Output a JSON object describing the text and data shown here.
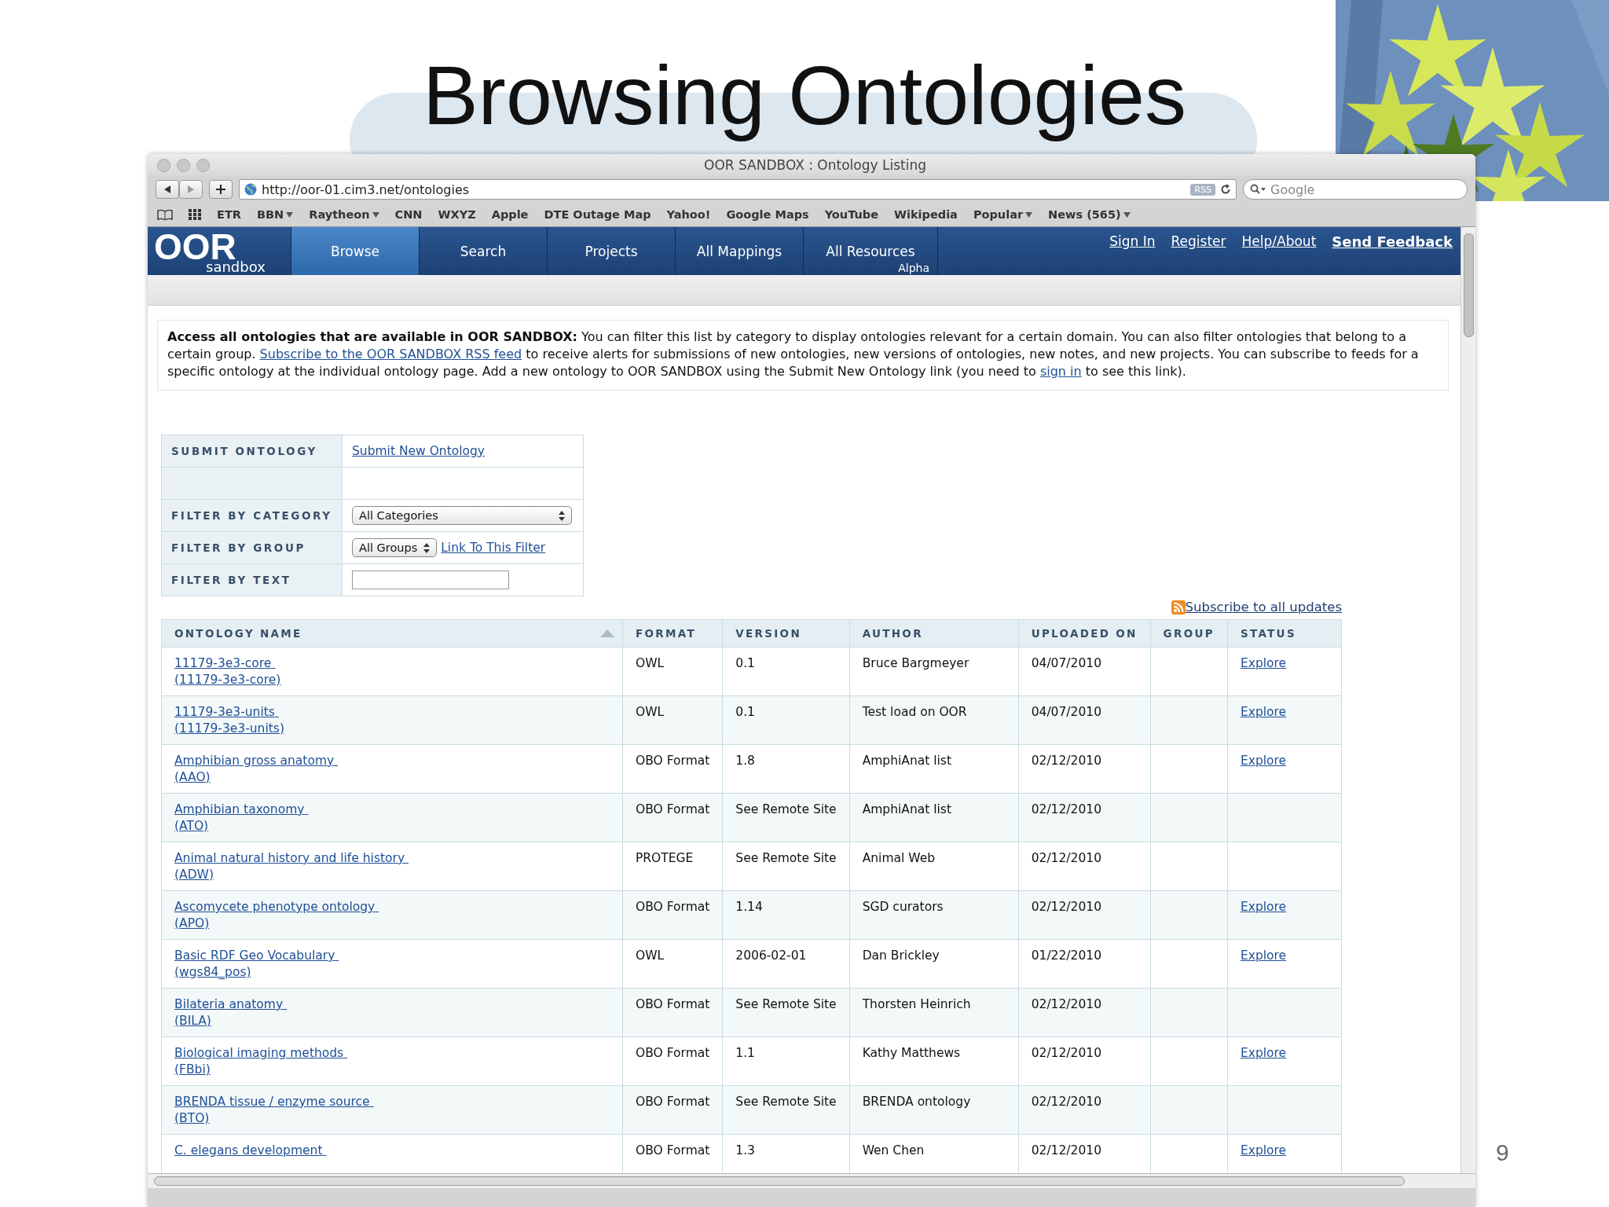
{
  "slide": {
    "title": "Browsing Ontologies",
    "page_number": "9"
  },
  "window": {
    "title": "OOR SANDBOX : Ontology Listing",
    "url": "http://oor-01.cim3.net/ontologies",
    "rss_badge": "RSS",
    "search_placeholder": "Google"
  },
  "bookmarks": [
    {
      "label": "ETR",
      "has_menu": false
    },
    {
      "label": "BBN",
      "has_menu": true
    },
    {
      "label": "Raytheon",
      "has_menu": true
    },
    {
      "label": "CNN",
      "has_menu": false
    },
    {
      "label": "WXYZ",
      "has_menu": false
    },
    {
      "label": "Apple",
      "has_menu": false
    },
    {
      "label": "DTE Outage Map",
      "has_menu": false
    },
    {
      "label": "Yahoo!",
      "has_menu": false
    },
    {
      "label": "Google Maps",
      "has_menu": false
    },
    {
      "label": "YouTube",
      "has_menu": false
    },
    {
      "label": "Wikipedia",
      "has_menu": false
    },
    {
      "label": "Popular",
      "has_menu": true
    },
    {
      "label": "News (565)",
      "has_menu": true
    }
  ],
  "site": {
    "logo": "OOR",
    "logo_sub": "sandbox",
    "nav": [
      {
        "label": "Browse",
        "selected": true
      },
      {
        "label": "Search",
        "selected": false
      },
      {
        "label": "Projects",
        "selected": false
      },
      {
        "label": "All Mappings",
        "selected": false
      },
      {
        "label": "All Resources",
        "sublabel": "Alpha",
        "selected": false
      }
    ],
    "account_links": [
      {
        "label": "Sign In",
        "bold": false
      },
      {
        "label": "Register",
        "bold": false
      },
      {
        "label": "Help/About",
        "bold": false
      },
      {
        "label": "Send Feedback",
        "bold": true
      }
    ]
  },
  "intro": [
    {
      "kind": "text",
      "text": "**Access all ontologies that are available in OOR SANDBOX:** You can filter this list by category to display ontologies relevant for a certain domain. You can also filter ontologies that belong to a certain group. "
    },
    {
      "kind": "link",
      "text": "Subscribe to the OOR SANDBOX RSS feed"
    },
    {
      "kind": "text",
      "text": " to receive alerts for submissions of new ontologies, new versions of ontologies, new notes, and new projects. You can subscribe to feeds for a specific ontology at the individual ontology page. Add a new ontology to OOR SANDBOX using the Submit New Ontology link (you need to "
    },
    {
      "kind": "link",
      "text": "sign in"
    },
    {
      "kind": "text",
      "text": " to see this link)."
    }
  ],
  "filters": [
    {
      "kind": "link",
      "label": "SUBMIT ONTOLOGY",
      "link": "Submit New Ontology"
    },
    {
      "kind": "blank"
    },
    {
      "kind": "select",
      "label": "FILTER BY CATEGORY",
      "value": "All Categories"
    },
    {
      "kind": "select_link",
      "label": "FILTER BY GROUP",
      "value": "All Groups",
      "link": "Link To This Filter"
    },
    {
      "kind": "input",
      "label": "FILTER BY TEXT"
    }
  ],
  "subscribe_link": "Subscribe to all updates",
  "table": {
    "columns": [
      {
        "label": "ONTOLOGY NAME",
        "sorted": true
      },
      {
        "label": "FORMAT",
        "sorted": false
      },
      {
        "label": "VERSION",
        "sorted": false
      },
      {
        "label": "AUTHOR",
        "sorted": false
      },
      {
        "label": "UPLOADED ON",
        "sorted": false
      },
      {
        "label": "GROUP",
        "sorted": false
      },
      {
        "label": "STATUS",
        "sorted": false
      }
    ],
    "rows": [
      {
        "name": "11179-3e3-core",
        "code": "(11179-3e3-core)",
        "format": "OWL",
        "version": "0.1",
        "author": "Bruce Bargmeyer",
        "uploaded": "04/07/2010",
        "status": "Explore"
      },
      {
        "name": "11179-3e3-units",
        "code": "(11179-3e3-units)",
        "format": "OWL",
        "version": "0.1",
        "author": "Test load on OOR",
        "uploaded": "04/07/2010",
        "status": "Explore"
      },
      {
        "name": "Amphibian gross anatomy",
        "code": "(AAO)",
        "format": "OBO Format",
        "version": "1.8",
        "author": "AmphiAnat list",
        "uploaded": "02/12/2010",
        "status": "Explore"
      },
      {
        "name": "Amphibian taxonomy",
        "code": "(ATO)",
        "format": "OBO Format",
        "version": "See Remote Site",
        "author": "AmphiAnat list",
        "uploaded": "02/12/2010"
      },
      {
        "name": "Animal natural history and life history",
        "code": "(ADW)",
        "format": "PROTEGE",
        "version": "See Remote Site",
        "author": "Animal Web",
        "uploaded": "02/12/2010"
      },
      {
        "name": "Ascomycete phenotype ontology",
        "code": "(APO)",
        "format": "OBO Format",
        "version": "1.14",
        "author": "SGD curators",
        "uploaded": "02/12/2010",
        "status": "Explore"
      },
      {
        "name": "Basic RDF Geo Vocabulary",
        "code": "(wgs84_pos)",
        "format": "OWL",
        "version": "2006-02-01",
        "author": "Dan Brickley",
        "uploaded": "01/22/2010",
        "status": "Explore"
      },
      {
        "name": "Bilateria anatomy",
        "code": "(BILA)",
        "format": "OBO Format",
        "version": "See Remote Site",
        "author": "Thorsten Heinrich",
        "uploaded": "02/12/2010"
      },
      {
        "name": "Biological imaging methods",
        "code": "(FBbi)",
        "format": "OBO Format",
        "version": "1.1",
        "author": "Kathy Matthews",
        "uploaded": "02/12/2010",
        "status": "Explore"
      },
      {
        "name": "BRENDA tissue / enzyme source",
        "code": "(BTO)",
        "format": "OBO Format",
        "version": "See Remote Site",
        "author": "BRENDA ontology",
        "uploaded": "02/12/2010"
      },
      {
        "name": "C. elegans development",
        "format": "OBO Format",
        "version": "1.3",
        "author": "Wen Chen",
        "uploaded": "02/12/2010",
        "status": "Explore"
      }
    ]
  }
}
